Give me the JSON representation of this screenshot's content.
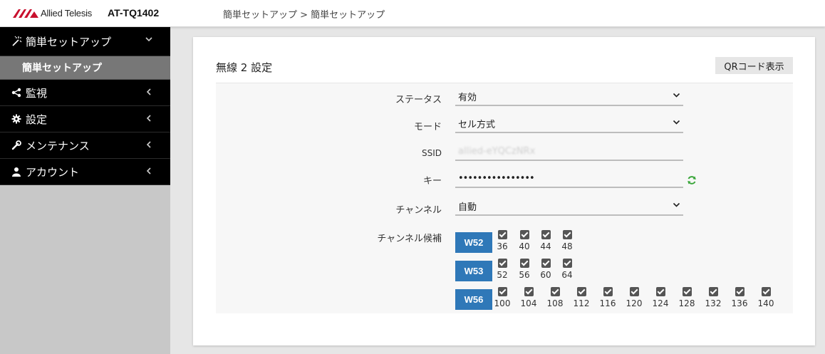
{
  "header": {
    "logo_text": "Allied Telesis",
    "model": "AT-TQ1402",
    "breadcrumb": "簡単セットアップ > 簡単セットアップ"
  },
  "sidebar": {
    "items": [
      {
        "label": "簡単セットアップ",
        "icon": "wand-icon",
        "expanded": true
      },
      {
        "label": "監視",
        "icon": "share-icon",
        "expanded": false
      },
      {
        "label": "設定",
        "icon": "gear-icon",
        "expanded": false
      },
      {
        "label": "メンテナンス",
        "icon": "wrench-icon",
        "expanded": false
      },
      {
        "label": "アカウント",
        "icon": "user-icon",
        "expanded": false
      }
    ],
    "subitem": "簡単セットアップ"
  },
  "main": {
    "title": "無線 2 設定",
    "qr_button": "QRコード表示",
    "fields": {
      "status": {
        "label": "ステータス",
        "value": "有効"
      },
      "mode": {
        "label": "モード",
        "value": "セル方式"
      },
      "ssid": {
        "label": "SSID",
        "value": "allied-eYQCzNRx"
      },
      "key": {
        "label": "キー",
        "value": "••••••••••••••••"
      },
      "channel": {
        "label": "チャンネル",
        "value": "自動"
      },
      "candidates": {
        "label": "チャンネル候補"
      }
    },
    "bands": [
      {
        "name": "W52",
        "channels": [
          "36",
          "40",
          "44",
          "48"
        ]
      },
      {
        "name": "W53",
        "channels": [
          "52",
          "56",
          "60",
          "64"
        ]
      },
      {
        "name": "W56",
        "channels": [
          "100",
          "104",
          "108",
          "112",
          "116",
          "120",
          "124",
          "128",
          "132",
          "136",
          "140"
        ]
      }
    ]
  },
  "colors": {
    "band_button": "#2f78b8",
    "sidebar_bg": "#000000",
    "sidebar_sub": "#777777",
    "refresh_icon": "#3aa63a"
  }
}
